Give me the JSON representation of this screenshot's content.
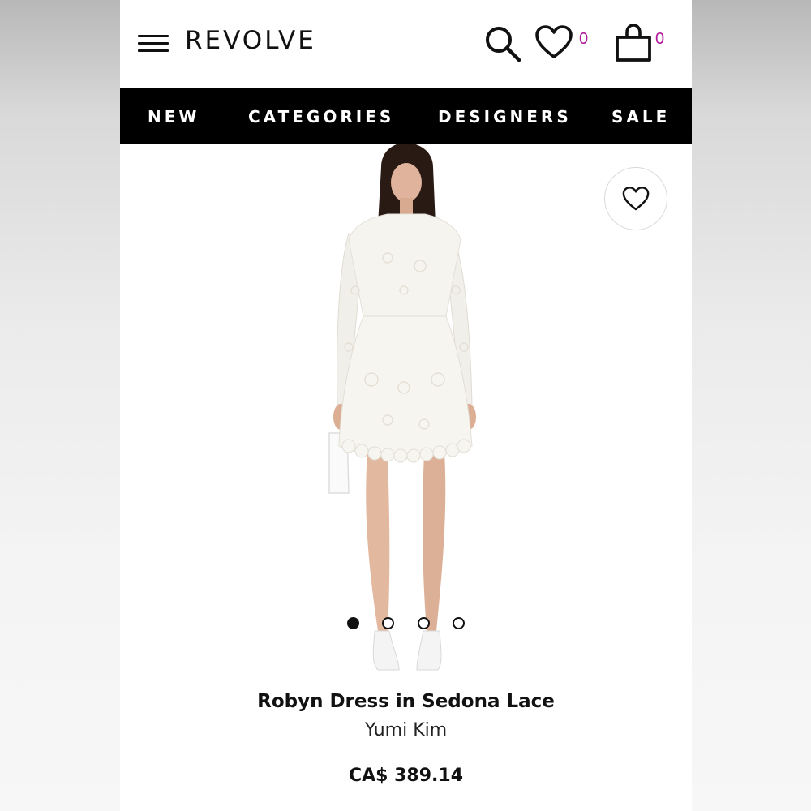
{
  "header": {
    "logo": "REVOLVE",
    "wishlist_count": "0",
    "bag_count": "0",
    "icons": [
      "menu-icon",
      "search-icon",
      "heart-icon",
      "bag-icon"
    ]
  },
  "nav": {
    "items": [
      {
        "label": "NEW"
      },
      {
        "label": "CATEGORIES"
      },
      {
        "label": "DESIGNERS"
      },
      {
        "label": "SALE"
      }
    ]
  },
  "gallery": {
    "image_count": 4,
    "active_index": 0,
    "favorite_icon": "heart-icon"
  },
  "product": {
    "title": "Robyn Dress in Sedona Lace",
    "brand": "Yumi Kim",
    "price": "CA$ 389.14"
  },
  "colors": {
    "nav_bg": "#000000",
    "badge_count": "#b0179a"
  }
}
